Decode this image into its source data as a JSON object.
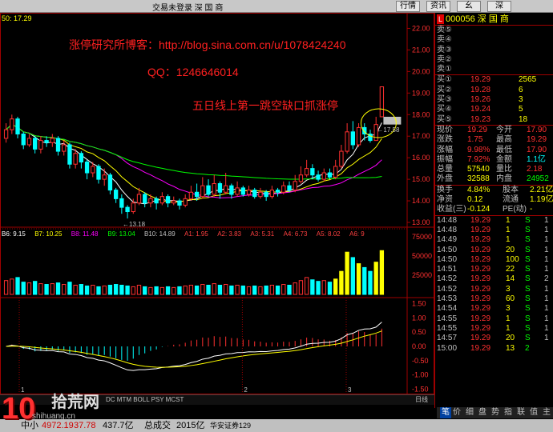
{
  "window": {
    "title": "交易未登录 深 国 商",
    "menu_buttons": [
      "行情",
      "资讯",
      "幺",
      "深"
    ]
  },
  "stock": {
    "tag": "L",
    "code": "000056",
    "name": "深 国 商"
  },
  "annotations": {
    "blog": "涨停研究所博客：http://blog.sina.com.cn/u/1078424240",
    "qq": "QQ：1246646014",
    "caption": "五日线上第一跳空缺口抓涨停"
  },
  "header_readout": "50: 17.29",
  "ma_legend": [
    {
      "label": "B6: 9.15",
      "color": "#ffffff"
    },
    {
      "label": "B7: 10.25",
      "color": "#ffff00"
    },
    {
      "label": "B8: 11.48",
      "color": "#ff00ff"
    },
    {
      "label": "B9: 13.04",
      "color": "#00ff00"
    },
    {
      "label": "B10: 14.89",
      "color": "#c0c0c0"
    },
    {
      "label": "A1: 1.95",
      "color": "#ff4040"
    },
    {
      "label": "A2: 3.83",
      "color": "#ff4040"
    },
    {
      "label": "A3: 5.31",
      "color": "#ff4040"
    },
    {
      "label": "A4: 6.73",
      "color": "#ff4040"
    },
    {
      "label": "A5: 8.02",
      "color": "#ff4040"
    },
    {
      "label": "A6: 9",
      "color": "#ff4040"
    }
  ],
  "low_label": "←13.18",
  "last_label": "←17.58",
  "price_axis": [
    "22.00",
    "21.00",
    "20.00",
    "19.00",
    "18.00",
    "17.00",
    "16.00",
    "15.00",
    "14.00",
    "13.00"
  ],
  "volume_axis": [
    "75000",
    "50000",
    "25000"
  ],
  "macd_axis": [
    "1.50",
    "1.00",
    "0.50",
    "0.00",
    "-0.50",
    "-1.00",
    "-1.50"
  ],
  "time_ticks": [
    "1",
    "2",
    "3"
  ],
  "indicator_tabs": "DC  MTM  BOLL  PSY  MCST",
  "daily_label": "日线",
  "order_book": {
    "sells": [
      {
        "label": "卖⑤",
        "price": "",
        "vol": ""
      },
      {
        "label": "卖④",
        "price": "",
        "vol": ""
      },
      {
        "label": "卖③",
        "price": "",
        "vol": ""
      },
      {
        "label": "卖②",
        "price": "",
        "vol": ""
      },
      {
        "label": "卖①",
        "price": "",
        "vol": ""
      }
    ],
    "buys": [
      {
        "label": "买①",
        "price": "19.29",
        "vol": "2565"
      },
      {
        "label": "买②",
        "price": "19.28",
        "vol": "6"
      },
      {
        "label": "买③",
        "price": "19.26",
        "vol": "3"
      },
      {
        "label": "买④",
        "price": "19.24",
        "vo l": "5",
        "vol": "5"
      },
      {
        "label": "买⑤",
        "price": "19.23",
        "vol": "18"
      }
    ]
  },
  "quote": [
    {
      "l1": "现价",
      "v1": "19.29",
      "l2": "今开",
      "v2": "17.90"
    },
    {
      "l1": "涨跌",
      "v1": "1.75",
      "l2": "最高",
      "v2": "19.29"
    },
    {
      "l1": "涨幅",
      "v1": "9.98%",
      "l2": "最低",
      "v2": "17.90"
    },
    {
      "l1": "振幅",
      "v1": "7.92%",
      "l2": "金额",
      "v2": "1.1亿"
    },
    {
      "l1": "总量",
      "v1": "57540",
      "l2": "量比",
      "v2": "2.18"
    },
    {
      "l1": "外盘",
      "v1": "32588",
      "l2": "内盘",
      "v2": "24952"
    }
  ],
  "fundamentals": [
    {
      "l1": "换手",
      "v1": "4.84%",
      "l2": "股本",
      "v2": "2.21亿"
    },
    {
      "l1": "净资",
      "v1": "0.12",
      "l2": "流通",
      "v2": "1.19亿"
    },
    {
      "l1": "收益(三)",
      "v1": "-0.124",
      "l2": "PE(动)",
      "v2": "-"
    }
  ],
  "ticks": [
    {
      "time": "14:48",
      "price": "19.29",
      "vol": "1",
      "side": "S",
      "n": "1"
    },
    {
      "time": "14:48",
      "price": "19.29",
      "vol": "1",
      "side": "S",
      "n": "1"
    },
    {
      "time": "14:49",
      "price": "19.29",
      "vol": "1",
      "side": "S",
      "n": "1"
    },
    {
      "time": "14:50",
      "price": "19.29",
      "vol": "20",
      "side": "S",
      "n": "1"
    },
    {
      "time": "14:50",
      "price": "19.29",
      "vol": "100",
      "side": "S",
      "n": "1"
    },
    {
      "time": "14:51",
      "price": "19.29",
      "vol": "22",
      "side": "S",
      "n": "1"
    },
    {
      "time": "14:52",
      "price": "19.29",
      "vol": "14",
      "side": "S",
      "n": "2"
    },
    {
      "time": "14:52",
      "price": "19.29",
      "vol": "3",
      "side": "S",
      "n": "1"
    },
    {
      "time": "14:53",
      "price": "19.29",
      "vol": "60",
      "side": "S",
      "n": "1"
    },
    {
      "time": "14:54",
      "price": "19.29",
      "vol": "3",
      "side": "S",
      "n": "1"
    },
    {
      "time": "14:55",
      "price": "19.29",
      "vol": "1",
      "side": "S",
      "n": "1"
    },
    {
      "time": "14:55",
      "price": "19.29",
      "vol": "1",
      "side": "S",
      "n": "1"
    },
    {
      "time": "14:57",
      "price": "19.29",
      "vol": "20",
      "side": "S",
      "n": "1"
    },
    {
      "time": "15:00",
      "price": "19.29",
      "vol": "13",
      "side": "2",
      "n": ""
    }
  ],
  "panel_tabs": [
    "笔",
    "价",
    "细",
    "盘",
    "势",
    "指",
    "联",
    "值",
    "主"
  ],
  "status": {
    "index_label": "中小",
    "index_value": "4972.19",
    "index_change": "37.78",
    "amount": "437.7亿",
    "total_label": "总成交",
    "total_value": "2015亿",
    "broker": "华安证券129"
  },
  "watermark": {
    "big": "10",
    "name": "拾荒网",
    "url": "shihuang.cn"
  },
  "colors": {
    "up": "#ff3030",
    "down": "#00ffff",
    "ma5": "#ffffff",
    "ma10": "#ffff00",
    "ma20": "#ff00ff",
    "ma60": "#00ff00",
    "grid": "#a00000",
    "volume_up": "#ffff00"
  },
  "chart_data": {
    "type": "candlestick",
    "ylim": [
      13,
      22.5
    ],
    "candles": [
      [
        16.9,
        17.3,
        17.6,
        16.7
      ],
      [
        17.3,
        17.8,
        18.0,
        17.1
      ],
      [
        17.8,
        17.1,
        17.9,
        16.9
      ],
      [
        17.1,
        16.6,
        17.2,
        16.4
      ],
      [
        16.6,
        16.9,
        17.1,
        16.5
      ],
      [
        16.9,
        16.4,
        17.0,
        16.2
      ],
      [
        16.4,
        16.8,
        17.0,
        16.2
      ],
      [
        16.8,
        16.7,
        17.0,
        16.5
      ],
      [
        16.7,
        16.9,
        17.1,
        16.5
      ],
      [
        16.9,
        16.3,
        17.0,
        16.1
      ],
      [
        16.3,
        16.6,
        16.8,
        16.1
      ],
      [
        16.6,
        15.7,
        16.7,
        15.5
      ],
      [
        15.7,
        16.2,
        16.4,
        15.5
      ],
      [
        16.2,
        15.8,
        16.3,
        15.5
      ],
      [
        15.8,
        15.3,
        15.9,
        15.0
      ],
      [
        15.3,
        15.6,
        15.8,
        15.1
      ],
      [
        15.6,
        15.0,
        15.7,
        14.8
      ],
      [
        15.0,
        15.2,
        15.5,
        14.7
      ],
      [
        15.2,
        14.5,
        15.3,
        14.3
      ],
      [
        14.5,
        14.1,
        14.6,
        13.9
      ],
      [
        14.1,
        13.7,
        14.3,
        13.4
      ],
      [
        13.7,
        13.5,
        13.8,
        13.18
      ],
      [
        13.5,
        13.9,
        14.1,
        13.4
      ],
      [
        13.9,
        14.3,
        14.6,
        13.8
      ],
      [
        14.3,
        13.9,
        14.4,
        13.7
      ],
      [
        13.9,
        14.1,
        14.3,
        13.7
      ],
      [
        14.1,
        13.9,
        14.2,
        13.6
      ],
      [
        13.9,
        14.2,
        14.4,
        13.8
      ],
      [
        14.2,
        13.9,
        14.3,
        13.7
      ],
      [
        13.9,
        14.0,
        14.2,
        13.8
      ],
      [
        14.0,
        13.8,
        14.1,
        13.6
      ],
      [
        13.8,
        14.1,
        14.3,
        13.7
      ],
      [
        14.1,
        14.4,
        14.7,
        14.0
      ],
      [
        14.4,
        14.2,
        14.8,
        14.0
      ],
      [
        14.2,
        14.7,
        15.1,
        14.1
      ],
      [
        14.7,
        14.3,
        15.0,
        14.2
      ],
      [
        14.3,
        14.8,
        15.2,
        14.2
      ],
      [
        14.8,
        14.4,
        14.9,
        14.1
      ],
      [
        14.4,
        14.7,
        15.3,
        14.3
      ],
      [
        14.7,
        14.3,
        14.8,
        14.1
      ],
      [
        14.3,
        14.6,
        14.9,
        14.2
      ],
      [
        14.6,
        14.3,
        14.7,
        14.2
      ],
      [
        14.3,
        14.5,
        14.7,
        14.2
      ],
      [
        14.5,
        14.2,
        14.6,
        14.1
      ],
      [
        14.2,
        14.4,
        14.6,
        14.1
      ],
      [
        14.4,
        14.2,
        14.5,
        14.0
      ],
      [
        14.2,
        14.5,
        14.7,
        14.1
      ],
      [
        14.5,
        14.4,
        14.6,
        14.2
      ],
      [
        14.4,
        14.7,
        14.9,
        14.3
      ],
      [
        14.7,
        14.5,
        14.9,
        14.4
      ],
      [
        14.5,
        14.9,
        15.2,
        14.4
      ],
      [
        14.9,
        15.2,
        15.6,
        14.8
      ],
      [
        15.2,
        15.5,
        15.9,
        15.1
      ],
      [
        15.5,
        15.2,
        15.7,
        15.0
      ],
      [
        15.2,
        15.0,
        15.4,
        14.9
      ],
      [
        15.0,
        15.3,
        15.5,
        14.9
      ],
      [
        15.3,
        15.1,
        15.5,
        15.0
      ],
      [
        15.1,
        15.6,
        15.9,
        15.0
      ],
      [
        15.6,
        16.3,
        16.6,
        15.5
      ],
      [
        16.3,
        17.2,
        17.6,
        16.2
      ],
      [
        17.2,
        16.6,
        17.7,
        16.4
      ],
      [
        16.6,
        17.4,
        17.6,
        16.5
      ],
      [
        17.4,
        17.1,
        17.6,
        16.8
      ],
      [
        17.1,
        16.8,
        17.3,
        16.7
      ],
      [
        16.8,
        17.54,
        17.9,
        16.8
      ],
      [
        17.9,
        19.29,
        19.29,
        17.9
      ]
    ],
    "volumes": [
      18,
      20,
      22,
      16,
      15,
      17,
      14,
      13,
      14,
      15,
      13,
      16,
      12,
      13,
      11,
      12,
      10,
      11,
      12,
      13,
      12,
      11,
      10,
      12,
      10,
      9,
      10,
      9,
      10,
      9,
      10,
      11,
      12,
      11,
      13,
      12,
      14,
      12,
      13,
      11,
      12,
      11,
      10,
      11,
      10,
      11,
      12,
      11,
      13,
      12,
      15,
      18,
      22,
      19,
      17,
      18,
      16,
      20,
      30,
      55,
      48,
      40,
      35,
      30,
      42,
      57
    ]
  }
}
